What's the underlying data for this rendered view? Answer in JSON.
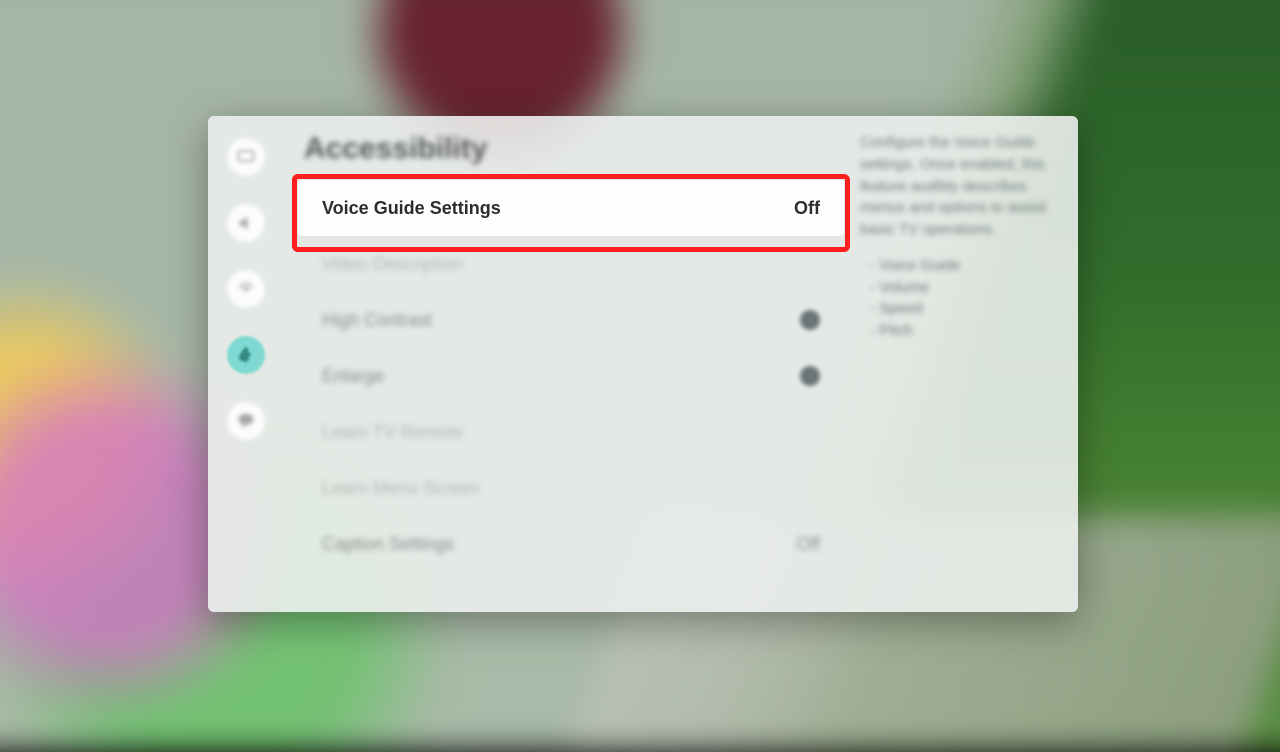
{
  "page_title": "Accessibility",
  "rows": [
    {
      "label": "Voice Guide Settings",
      "value": "Off",
      "selected": true,
      "disabled": false,
      "kind": "value"
    },
    {
      "label": "Video Description",
      "value": "",
      "selected": false,
      "disabled": true,
      "kind": "plain"
    },
    {
      "label": "High Contrast",
      "value": "",
      "selected": false,
      "disabled": false,
      "kind": "toggle"
    },
    {
      "label": "Enlarge",
      "value": "",
      "selected": false,
      "disabled": false,
      "kind": "toggle"
    },
    {
      "label": "Learn TV Remote",
      "value": "",
      "selected": false,
      "disabled": true,
      "kind": "plain"
    },
    {
      "label": "Learn Menu Screen",
      "value": "",
      "selected": false,
      "disabled": true,
      "kind": "plain"
    },
    {
      "label": "Caption Settings",
      "value": "Off",
      "selected": false,
      "disabled": false,
      "kind": "value"
    }
  ],
  "help": {
    "text": "Configure the Voice Guide settings. Once enabled, this feature audibly describes menus and options to assist basic TV operations.",
    "bullets": [
      "Voice Guide",
      "Volume",
      "Speed",
      "Pitch"
    ]
  },
  "icons": [
    "picture-icon",
    "sound-icon",
    "broadcast-icon",
    "general-icon",
    "support-icon"
  ]
}
